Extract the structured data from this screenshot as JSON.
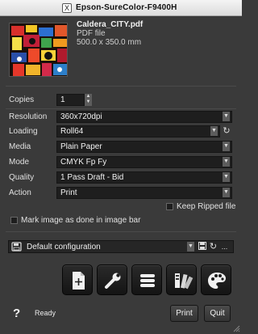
{
  "window": {
    "title": "Epson-SureColor-F9400H",
    "app_icon": "x-icon"
  },
  "file": {
    "name": "Caldera_CITY.pdf",
    "type": "PDF file",
    "size": "500.0 x 350.0 mm"
  },
  "settings": {
    "copies": {
      "label": "Copies",
      "value": "1"
    },
    "resolution": {
      "label": "Resolution",
      "value": "360x720dpi"
    },
    "loading": {
      "label": "Loading",
      "value": "Roll64"
    },
    "media": {
      "label": "Media",
      "value": "Plain Paper"
    },
    "mode": {
      "label": "Mode",
      "value": "CMYK Fp Fy"
    },
    "quality": {
      "label": "Quality",
      "value": "1 Pass Draft - Bid"
    },
    "action": {
      "label": "Action",
      "value": "Print"
    }
  },
  "options": {
    "keep_ripped": {
      "label": "Keep Ripped file",
      "checked": false
    },
    "mark_done": {
      "label": "Mark image as done in image bar",
      "checked": false
    }
  },
  "config": {
    "value": "Default configuration",
    "more": "..."
  },
  "toolbar": [
    "add-file-icon",
    "wrench-icon",
    "list-icon",
    "swatches-icon",
    "palette-icon"
  ],
  "footer": {
    "help": "?",
    "status": "Ready",
    "print_label": "Print",
    "quit_label": "Quit"
  },
  "colors": {
    "background": "#3a3a3a",
    "field": "#1e1e1e",
    "text": "#e6e6e6"
  }
}
